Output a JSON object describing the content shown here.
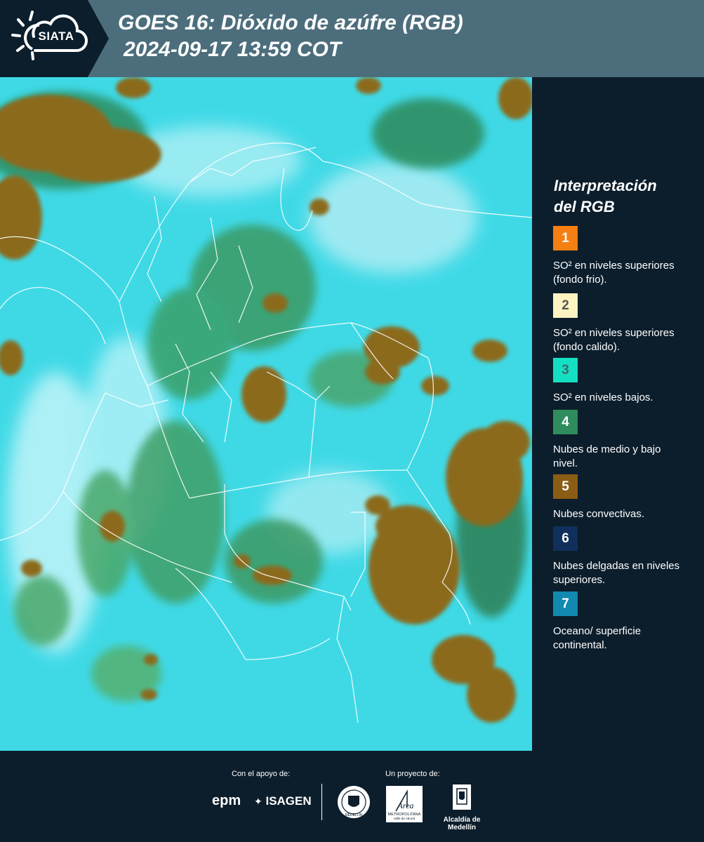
{
  "header": {
    "logo_text": "SIATA",
    "title_line1": "GOES 16: Dióxido de azúfre (RGB)",
    "title_line2": "2024-09-17 13:59 COT"
  },
  "legend": {
    "title_line1": "Interpretación",
    "title_line2": "del RGB",
    "items": [
      {
        "number": "1",
        "color": "#f57f12",
        "label": "SO² en niveles superiores (fondo frio)."
      },
      {
        "number": "2",
        "color": "#fdf4c1",
        "label": "SO² en niveles superiores (fondo calido)."
      },
      {
        "number": "3",
        "color": "#15dfc2",
        "label": "SO² en niveles bajos."
      },
      {
        "number": "4",
        "color": "#2e8c5d",
        "label": "Nubes de medio y bajo nivel."
      },
      {
        "number": "5",
        "color": "#8b5c14",
        "label": "Nubes convectivas."
      },
      {
        "number": "6",
        "color": "#102f5c",
        "label": "Nubes delgadas en niveles superiores."
      },
      {
        "number": "7",
        "color": "#1289b0",
        "label": "Oceano/ superficie continental."
      }
    ]
  },
  "footer": {
    "support_label": "Con el apoyo de:",
    "project_label": "Un proyecto de:",
    "sponsor_1": "epm",
    "sponsor_2": "ISAGEN",
    "partner_area_main": "Área",
    "partner_area_sub1": "METROPOLITANA",
    "partner_area_sub2": "Valle de Aburrá",
    "partner_alcaldia": "Alcaldía de Medellín",
    "seal_text": "MEDELLÍN"
  },
  "map": {
    "colors": {
      "ocean_land": "#3fd9e6",
      "low_level_clouds": "#2e8c5d",
      "convective_clouds": "#8b6a1e"
    }
  }
}
